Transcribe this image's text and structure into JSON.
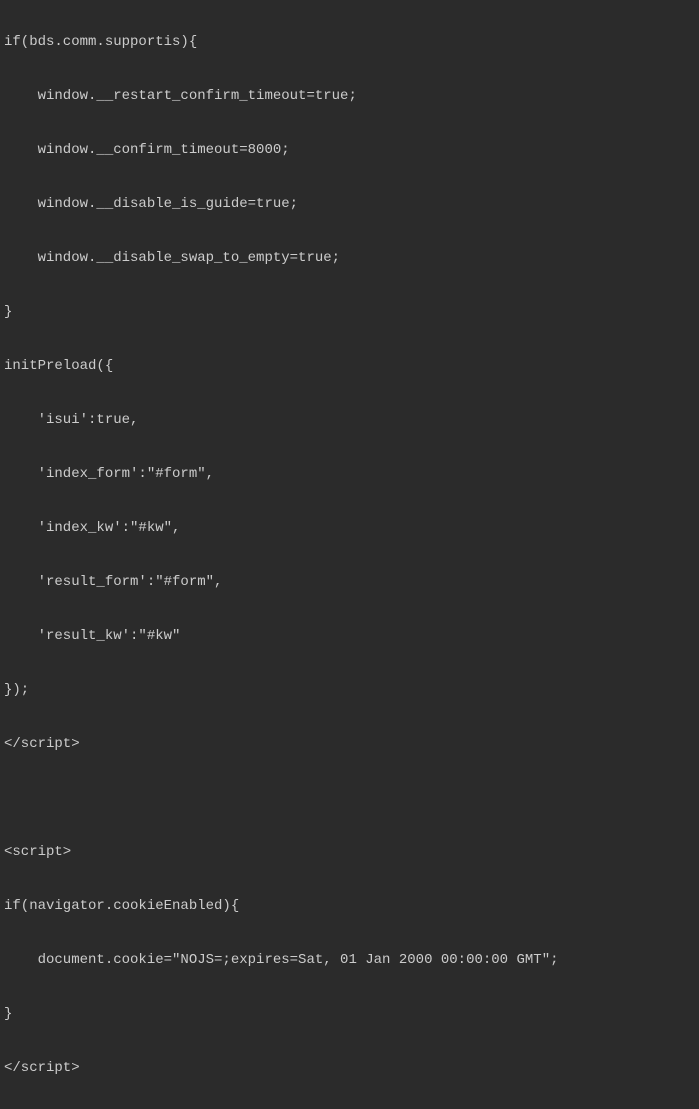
{
  "lines": [
    "if(bds.comm.supportis){",
    "    window.__restart_confirm_timeout=true;",
    "    window.__confirm_timeout=8000;",
    "    window.__disable_is_guide=true;",
    "    window.__disable_swap_to_empty=true;",
    "}",
    "initPreload({",
    "    'isui':true,",
    "    'index_form':\"#form\",",
    "    'index_kw':\"#kw\",",
    "    'result_form':\"#form\",",
    "    'result_kw':\"#kw\"",
    "});",
    "</scr_ipt>",
    "",
    "<scr_ipt>",
    "if(navigator.cookieEnabled){",
    "    document.cookie=\"NOJS=;expires=Sat, 01 Jan 2000 00:00:00 GMT\";",
    "}",
    "</scr_ipt>"
  ]
}
